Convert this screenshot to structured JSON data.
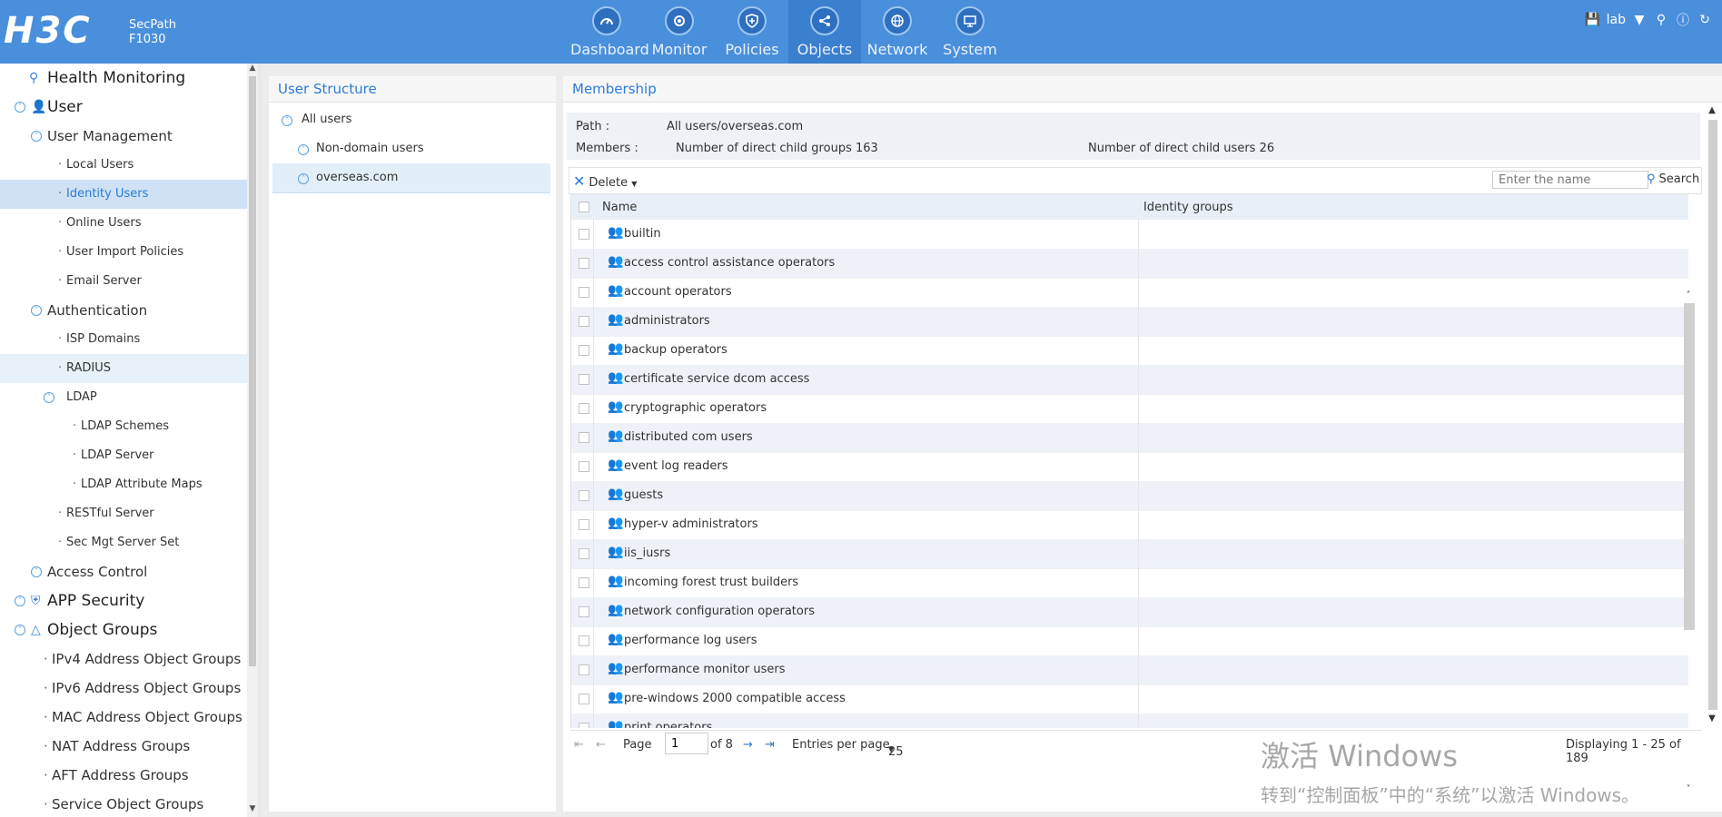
{
  "header": {
    "logo": "H3C",
    "model_line1": "SecPath",
    "model_line2": "F1030",
    "nav": [
      {
        "label": "Dashboard",
        "icon": "gauge-icon"
      },
      {
        "label": "Monitor",
        "icon": "monitor-eye-icon"
      },
      {
        "label": "Policies",
        "icon": "shield-icon"
      },
      {
        "label": "Objects",
        "icon": "share-nodes-icon",
        "active": true
      },
      {
        "label": "Network",
        "icon": "globe-icon"
      },
      {
        "label": "System",
        "icon": "display-icon"
      }
    ],
    "user": "lab"
  },
  "sidebar": {
    "items": [
      {
        "label": "Health Monitoring",
        "level": 0
      },
      {
        "label": "User",
        "level": 0
      },
      {
        "label": "User Management",
        "level": 1
      },
      {
        "label": "Local Users",
        "level": 2
      },
      {
        "label": "Identity Users",
        "level": 2,
        "selected": true
      },
      {
        "label": "Online Users",
        "level": 2
      },
      {
        "label": "User Import Policies",
        "level": 2
      },
      {
        "label": "Email Server",
        "level": 2
      },
      {
        "label": "Authentication",
        "level": 1
      },
      {
        "label": "ISP Domains",
        "level": 2
      },
      {
        "label": "RADIUS",
        "level": 2
      },
      {
        "label": "LDAP",
        "level": 2
      },
      {
        "label": "LDAP Schemes",
        "level": 3
      },
      {
        "label": "LDAP Server",
        "level": 3
      },
      {
        "label": "LDAP Attribute Maps",
        "level": 3
      },
      {
        "label": "RESTful Server",
        "level": 2
      },
      {
        "label": "Sec Mgt Server Set",
        "level": 2
      },
      {
        "label": "Access Control",
        "level": 1
      },
      {
        "label": "APP Security",
        "level": 0
      },
      {
        "label": "Object Groups",
        "level": 0
      },
      {
        "label": "IPv4 Address Object Groups",
        "level": 1
      },
      {
        "label": "IPv6 Address Object Groups",
        "level": 1
      },
      {
        "label": "MAC Address Object Groups",
        "level": 1
      },
      {
        "label": "NAT Address Groups",
        "level": 1
      },
      {
        "label": "AFT Address Groups",
        "level": 1
      },
      {
        "label": "Service Object Groups",
        "level": 1
      }
    ]
  },
  "user_structure": {
    "title": "User Structure",
    "items": [
      {
        "label": "All users"
      },
      {
        "label": "Non-domain users"
      },
      {
        "label": "overseas.com",
        "selected": true
      }
    ]
  },
  "membership": {
    "title": "Membership",
    "path_label": "Path :",
    "path_value": "All users/overseas.com",
    "members_label": "Members :",
    "child_groups": "Number of direct child groups 163",
    "child_users": "Number of direct child users 26",
    "delete_label": "Delete",
    "search_placeholder": "Enter the name",
    "search_label": "Search",
    "columns": [
      "Name",
      "Identity groups"
    ],
    "rows": [
      "builtin",
      "access control assistance operators",
      "account operators",
      "administrators",
      "backup operators",
      "certificate service dcom access",
      "cryptographic operators",
      "distributed com users",
      "event log readers",
      "guests",
      "hyper-v administrators",
      "iis_iusrs",
      "incoming forest trust builders",
      "network configuration operators",
      "performance log users",
      "performance monitor users",
      "pre-windows 2000 compatible access",
      "print operators"
    ],
    "pager": {
      "page_label": "Page",
      "page_value": "1",
      "of_label": "of 8",
      "entries_label": "Entries per page",
      "entries_value": "25",
      "display_text": "Displaying 1 - 25 of 189"
    }
  },
  "watermark": {
    "line1": "激活 Windows",
    "line2": "转到“控制面板”中的“系统”以激活 Windows。"
  }
}
